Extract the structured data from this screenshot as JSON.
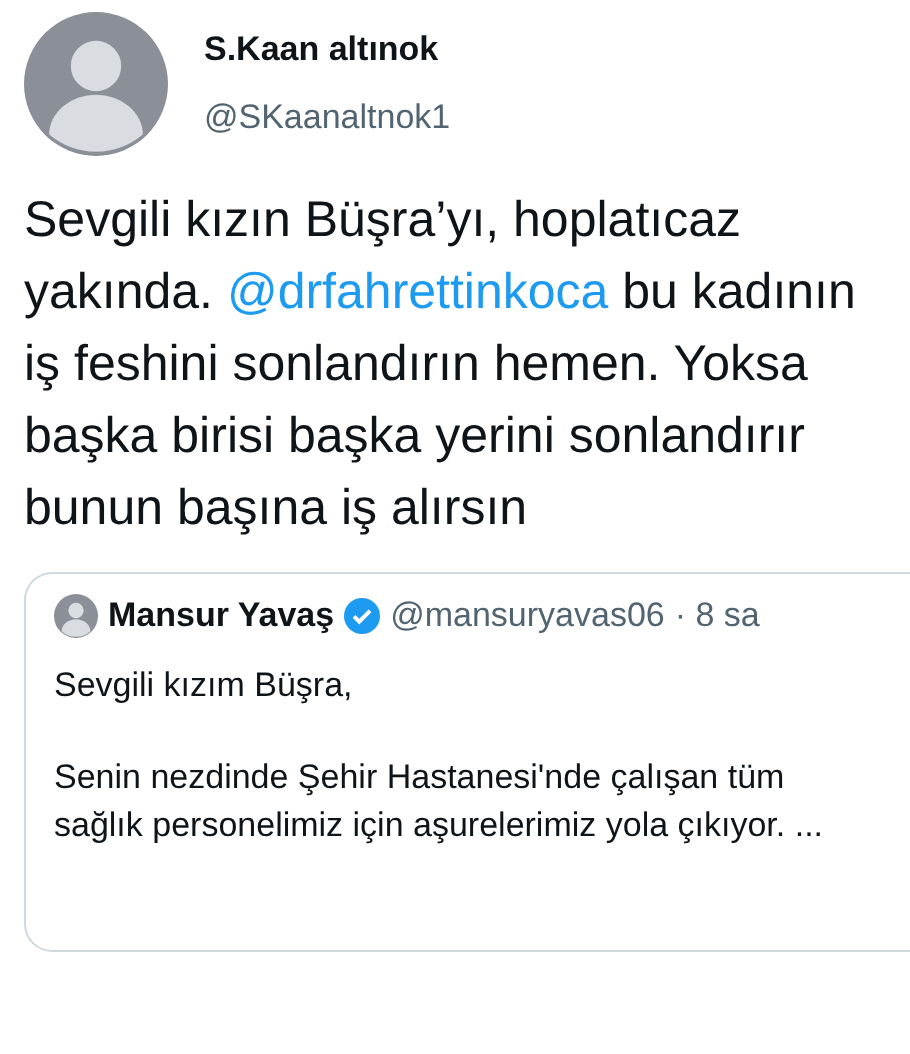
{
  "author": {
    "name": "S.Kaan altınok",
    "handle": "@SKaanaltnok1"
  },
  "tweet": {
    "segments": [
      {
        "kind": "plain",
        "text": "Sevgili kızın Büşra’yı, hoplatıcaz yakında. "
      },
      {
        "kind": "mention",
        "text": "@drfahrettinkoca"
      },
      {
        "kind": "plain",
        "text": " bu kadının iş feshini sonlandırın hemen. Yoksa başka birisi başka yerini sonlandırır bunun başına iş alırsın"
      }
    ]
  },
  "quoted": {
    "name": "Mansur Yavaş",
    "verified": true,
    "handle": "@mansuryavas06",
    "time": "· 8 sa",
    "paragraphs": [
      "Sevgili kızım Büşra,",
      "Senin nezdinde Şehir Hastanesi'nde çalışan tüm sağlık personelimiz için aşurelerimiz yola çıkıyor. ..."
    ]
  }
}
